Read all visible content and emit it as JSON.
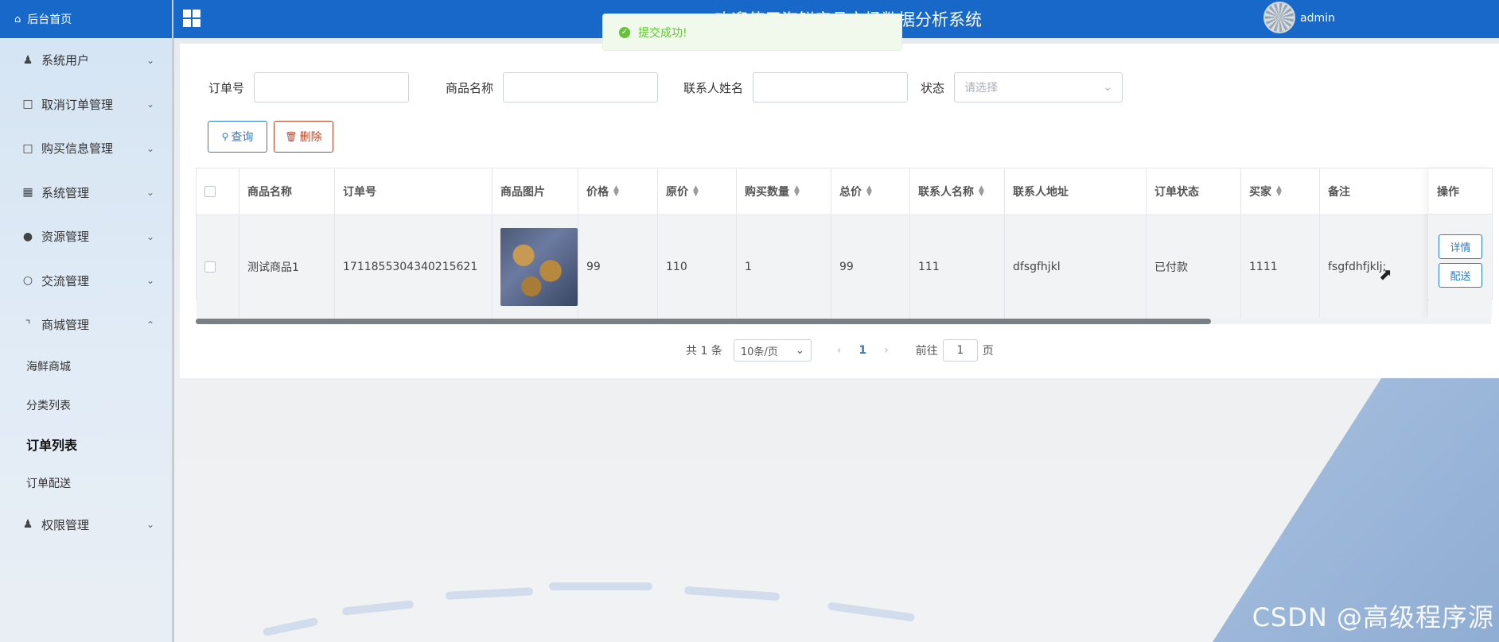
{
  "sidebar": {
    "home": "后台首页",
    "items": [
      {
        "label": "系统用户",
        "icon": "user-icon",
        "expanded": false
      },
      {
        "label": "取消订单管理",
        "icon": "order-icon",
        "expanded": false
      },
      {
        "label": "购买信息管理",
        "icon": "order-icon",
        "expanded": false
      },
      {
        "label": "系统管理",
        "icon": "image-icon",
        "expanded": false
      },
      {
        "label": "资源管理",
        "icon": "bulb-icon",
        "expanded": false
      },
      {
        "label": "交流管理",
        "icon": "chat-icon",
        "expanded": false
      },
      {
        "label": "商城管理",
        "icon": "cart-icon",
        "expanded": true
      }
    ],
    "subitems": [
      "海鲜商城",
      "分类列表",
      "订单列表",
      "订单配送"
    ],
    "active_subitem": "订单列表",
    "last_item": {
      "label": "权限管理",
      "icon": "user-icon"
    }
  },
  "header": {
    "title": "欢迎使用海鲜产品市场数据分析系统",
    "user": "admin"
  },
  "toast": {
    "message": "提交成功!"
  },
  "filters": {
    "order_no_label": "订单号",
    "product_name_label": "商品名称",
    "contact_label": "联系人姓名",
    "status_label": "状态",
    "status_placeholder": "请选择"
  },
  "buttons": {
    "query": "查询",
    "delete": "删除"
  },
  "table": {
    "headers": [
      "商品名称",
      "订单号",
      "商品图片",
      "价格",
      "原价",
      "购买数量",
      "总价",
      "联系人名称",
      "联系人地址",
      "订单状态",
      "买家",
      "备注",
      "操作"
    ],
    "rows": [
      {
        "product_name": "测试商品1",
        "order_no": "1711855304340215621",
        "price": "99",
        "original_price": "110",
        "quantity": "1",
        "total": "99",
        "contact_name": "111",
        "address": "dfsgfhjkl",
        "status": "已付款",
        "buyer": "1111",
        "remark": "fsgfdhfjklj;"
      }
    ],
    "actions": {
      "detail": "详情",
      "deliver": "配送"
    }
  },
  "pagination": {
    "total_text": "共 1 条",
    "page_size": "10条/页",
    "current_page": "1",
    "goto_label": "前往",
    "goto_value": "1",
    "page_suffix": "页"
  },
  "watermark": "CSDN @高级程序源"
}
